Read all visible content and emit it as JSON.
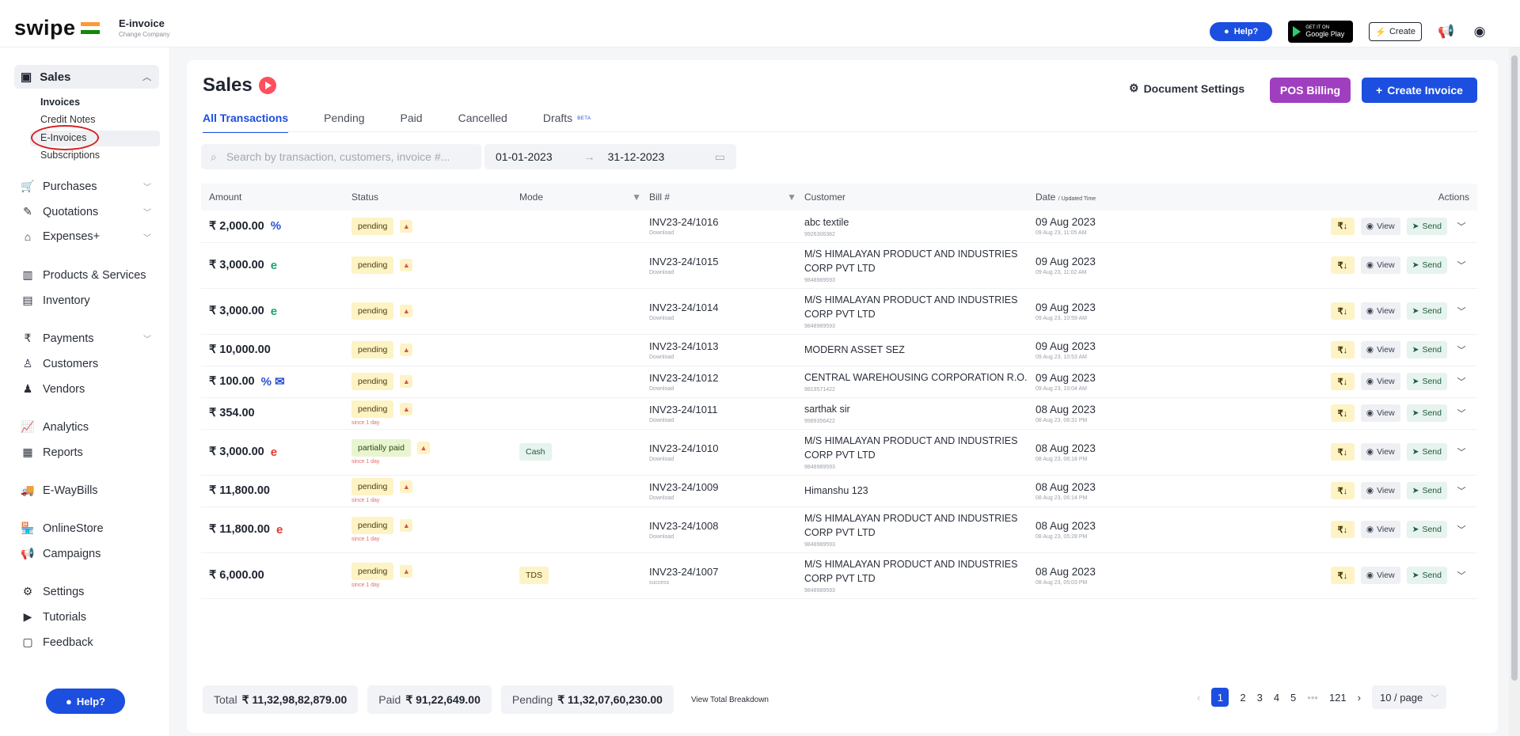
{
  "topbar": {
    "logo": "swipe",
    "app_title": "E-invoice",
    "company": "Change Company",
    "help": "Help?",
    "playstore": "Google Play",
    "playstore_small": "GET IT ON",
    "create": "Create"
  },
  "sidebar": {
    "sales_label": "Sales",
    "sub": [
      "Invoices",
      "Credit Notes",
      "E-Invoices",
      "Subscriptions"
    ],
    "items": [
      "Purchases",
      "Quotations",
      "Expenses+",
      "Products & Services",
      "Inventory",
      "Payments",
      "Customers",
      "Vendors",
      "Analytics",
      "Reports",
      "E-WayBills",
      "OnlineStore",
      "Campaigns",
      "Settings",
      "Tutorials",
      "Feedback"
    ],
    "help": "Help?"
  },
  "page": {
    "title": "Sales",
    "doc_settings": "Document Settings",
    "pos_billing": "POS Billing",
    "create_invoice": "Create Invoice",
    "tabs": [
      "All Transactions",
      "Pending",
      "Paid",
      "Cancelled",
      "Drafts"
    ],
    "beta": "BETA",
    "search_placeholder": "Search by transaction, customers, invoice #...",
    "date_from": "01-01-2023",
    "date_to": "31-12-2023"
  },
  "table": {
    "headers": {
      "amount": "Amount",
      "status": "Status",
      "mode": "Mode",
      "bill": "Bill #",
      "customer": "Customer",
      "date": "Date",
      "date_sub": "/ Updated Time",
      "actions": "Actions"
    },
    "action_view": "View",
    "action_send": "Send",
    "rows": [
      {
        "amount": "₹ 2,000.00",
        "mark": "%",
        "markc": "blue",
        "status": "pending",
        "since": "",
        "mode": "",
        "bill": "INV23-24/1016",
        "bill_sub": "Download",
        "customer": [
          "abc textile"
        ],
        "cust_sub": "9926306382",
        "date": "09 Aug 2023",
        "date_sub": "09 Aug 23, 11:05 AM"
      },
      {
        "amount": "₹ 3,000.00",
        "mark": "e",
        "markc": "green",
        "status": "pending",
        "since": "",
        "mode": "",
        "bill": "INV23-24/1015",
        "bill_sub": "Download",
        "customer": [
          "M/S HIMALAYAN PRODUCT AND INDUSTRIES",
          "CORP PVT LTD"
        ],
        "cust_sub": "9848989593",
        "date": "09 Aug 2023",
        "date_sub": "09 Aug 23, 11:02 AM"
      },
      {
        "amount": "₹ 3,000.00",
        "mark": "e",
        "markc": "green",
        "status": "pending",
        "since": "",
        "mode": "",
        "bill": "INV23-24/1014",
        "bill_sub": "Download",
        "customer": [
          "M/S HIMALAYAN PRODUCT AND INDUSTRIES",
          "CORP PVT LTD"
        ],
        "cust_sub": "9848989593",
        "date": "09 Aug 2023",
        "date_sub": "09 Aug 23, 10:59 AM"
      },
      {
        "amount": "₹ 10,000.00",
        "mark": "",
        "markc": "",
        "status": "pending",
        "since": "",
        "mode": "",
        "bill": "INV23-24/1013",
        "bill_sub": "Download",
        "customer": [
          "MODERN ASSET SEZ"
        ],
        "cust_sub": "",
        "date": "09 Aug 2023",
        "date_sub": "09 Aug 23, 10:53 AM"
      },
      {
        "amount": "₹ 100.00",
        "mark": "% ✉",
        "markc": "blue",
        "status": "pending",
        "since": "",
        "mode": "",
        "bill": "INV23-24/1012",
        "bill_sub": "Download",
        "customer": [
          "CENTRAL WAREHOUSING CORPORATION R.O."
        ],
        "cust_sub": "9819571422",
        "date": "09 Aug 2023",
        "date_sub": "09 Aug 23, 10:04 AM"
      },
      {
        "amount": "₹ 354.00",
        "mark": "",
        "markc": "",
        "status": "pending",
        "since": "since 1 day",
        "mode": "",
        "bill": "INV23-24/1011",
        "bill_sub": "Download",
        "customer": [
          "sarthak sir"
        ],
        "cust_sub": "9989356422",
        "date": "08 Aug 2023",
        "date_sub": "08 Aug 23, 06:31 PM"
      },
      {
        "amount": "₹ 3,000.00",
        "mark": "e",
        "markc": "red",
        "status": "partially paid",
        "since": "since 1 day",
        "mode": "Cash",
        "bill": "INV23-24/1010",
        "bill_sub": "Download",
        "customer": [
          "M/S HIMALAYAN PRODUCT AND INDUSTRIES",
          "CORP PVT LTD"
        ],
        "cust_sub": "9848989593",
        "date": "08 Aug 2023",
        "date_sub": "08 Aug 23, 06:18 PM"
      },
      {
        "amount": "₹ 11,800.00",
        "mark": "",
        "markc": "",
        "status": "pending",
        "since": "since 1 day",
        "mode": "",
        "bill": "INV23-24/1009",
        "bill_sub": "Download",
        "customer": [
          "Himanshu 123"
        ],
        "cust_sub": "",
        "date": "08 Aug 2023",
        "date_sub": "08 Aug 23, 06:14 PM"
      },
      {
        "amount": "₹ 11,800.00",
        "mark": "e",
        "markc": "red",
        "status": "pending",
        "since": "since 1 day",
        "mode": "",
        "bill": "INV23-24/1008",
        "bill_sub": "Download",
        "customer": [
          "M/S HIMALAYAN PRODUCT AND INDUSTRIES",
          "CORP PVT LTD"
        ],
        "cust_sub": "9848989593",
        "date": "08 Aug 2023",
        "date_sub": "08 Aug 23, 05:28 PM"
      },
      {
        "amount": "₹ 6,000.00",
        "mark": "",
        "markc": "",
        "status": "pending",
        "since": "since 1 day",
        "mode": "TDS",
        "bill": "INV23-24/1007",
        "bill_sub": "success",
        "customer": [
          "M/S HIMALAYAN PRODUCT AND INDUSTRIES",
          "CORP PVT LTD"
        ],
        "cust_sub": "9848989593",
        "date": "08 Aug 2023",
        "date_sub": "08 Aug 23, 05:03 PM"
      }
    ]
  },
  "footer": {
    "total_label": "Total",
    "total_value": "₹ 11,32,98,82,879.00",
    "paid_label": "Paid",
    "paid_value": "₹ 91,22,649.00",
    "pending_label": "Pending",
    "pending_value": "₹ 11,32,07,60,230.00",
    "breakdown": "View Total Breakdown"
  },
  "pagination": {
    "pages": [
      "1",
      "2",
      "3",
      "4",
      "5"
    ],
    "ellipsis": "•••",
    "last": "121",
    "size": "10 / page"
  }
}
